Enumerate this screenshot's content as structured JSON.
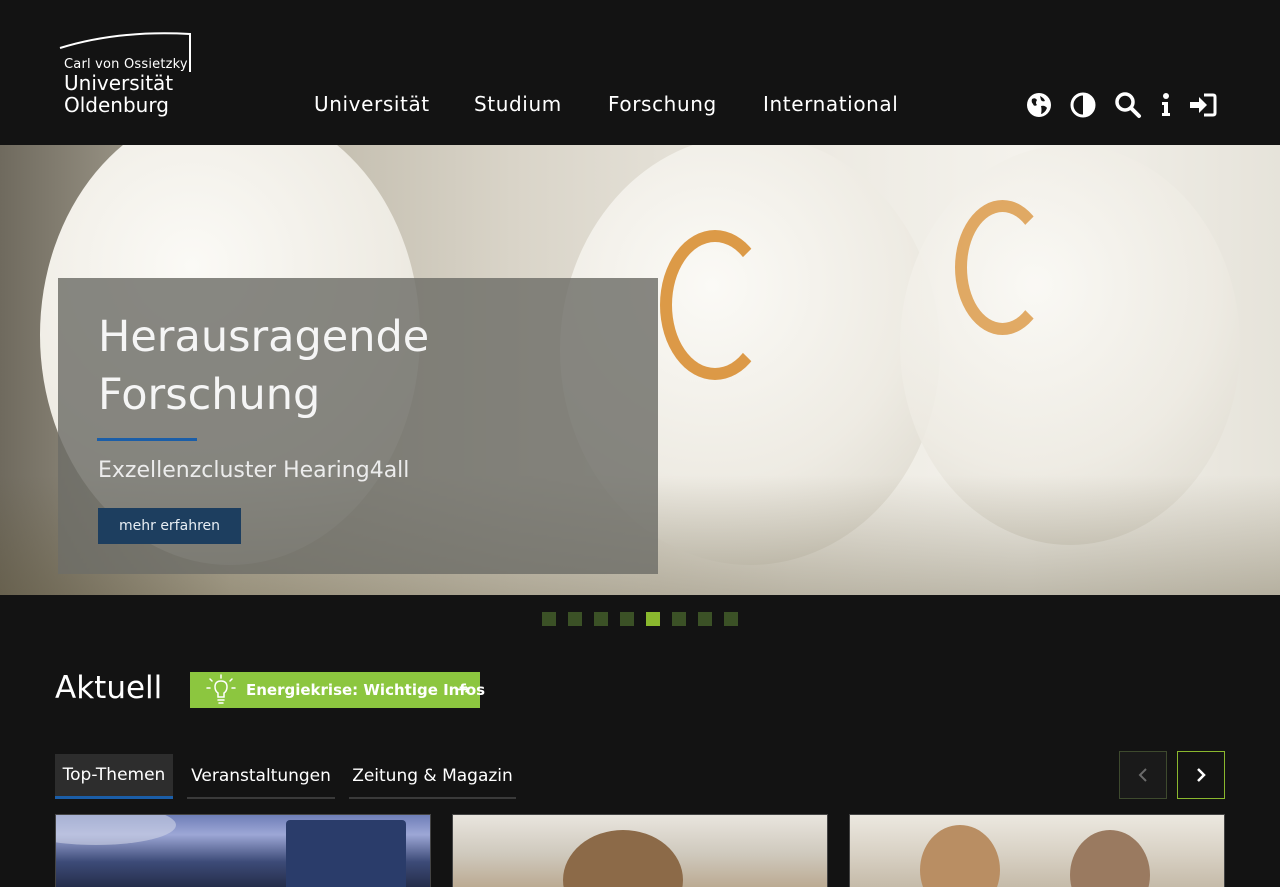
{
  "header": {
    "logo": {
      "line1": "Carl von Ossietzky",
      "line2": "Universität",
      "line3": "Oldenburg"
    },
    "nav": [
      {
        "label": "Universität"
      },
      {
        "label": "Studium"
      },
      {
        "label": "Forschung"
      },
      {
        "label": "International"
      }
    ],
    "tools": [
      {
        "icon": "globe-icon"
      },
      {
        "icon": "contrast-icon"
      },
      {
        "icon": "search-icon"
      },
      {
        "icon": "info-icon"
      },
      {
        "icon": "login-icon"
      }
    ]
  },
  "hero": {
    "title": "Herausragende Forschung",
    "subtitle": "Exzellenzcluster Hearing4all",
    "button_label": "mehr erfahren",
    "slides_total": 8,
    "active_slide": 5
  },
  "aktuell": {
    "title": "Aktuell",
    "energy_button": {
      "label": "Energiekrise: Wichtige Infos",
      "arrow": "→",
      "icon": "lightbulb-icon"
    },
    "tabs": [
      {
        "label": "Top-Themen",
        "active": true
      },
      {
        "label": "Veranstaltungen",
        "active": false
      },
      {
        "label": "Zeitung & Magazin",
        "active": false
      }
    ],
    "prev_icon": "chevron-left-icon",
    "next_icon": "chevron-right-icon"
  },
  "colors": {
    "background": "#131313",
    "accent_green": "#8cc63f",
    "accent_blue": "#1b5ea8",
    "button_dark_blue": "#1d3e5f"
  }
}
